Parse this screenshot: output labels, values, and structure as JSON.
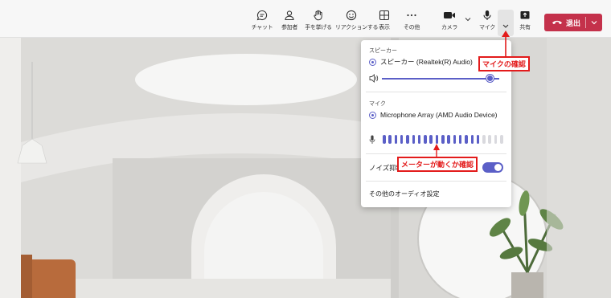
{
  "toolbar": {
    "items": [
      {
        "label": "チャット",
        "icon": "chat-icon"
      },
      {
        "label": "参加者",
        "icon": "people-icon"
      },
      {
        "label": "手を挙げる",
        "icon": "raise-hand-icon"
      },
      {
        "label": "リアクションする",
        "icon": "smile-icon"
      },
      {
        "label": "表示",
        "icon": "view-grid-icon"
      },
      {
        "label": "その他",
        "icon": "more-icon"
      },
      {
        "label": "カメラ",
        "icon": "camera-icon"
      },
      {
        "label": "マイク",
        "icon": "mic-icon"
      },
      {
        "label": "共有",
        "icon": "share-icon"
      }
    ],
    "leave_label": "退出"
  },
  "panel": {
    "speaker_title": "スピーカー",
    "speaker_device": "スピーカー (Realtek(R) Audio)",
    "speaker_volume": 0.92,
    "mic_title": "マイク",
    "mic_device": "Microphone Array (AMD Audio Device)",
    "mic_level_active": 17,
    "mic_level_total": 21,
    "noise_label": "ノイズ抑制",
    "noise_enabled": true,
    "more_audio_label": "その他のオーディオ設定"
  },
  "annotations": {
    "mic_check": "マイクの確認",
    "meter_check": "メーターが動くか確認"
  },
  "colors": {
    "accent": "#5b5fc7",
    "leave": "#c4314b",
    "annotation": "#e31b1b"
  }
}
